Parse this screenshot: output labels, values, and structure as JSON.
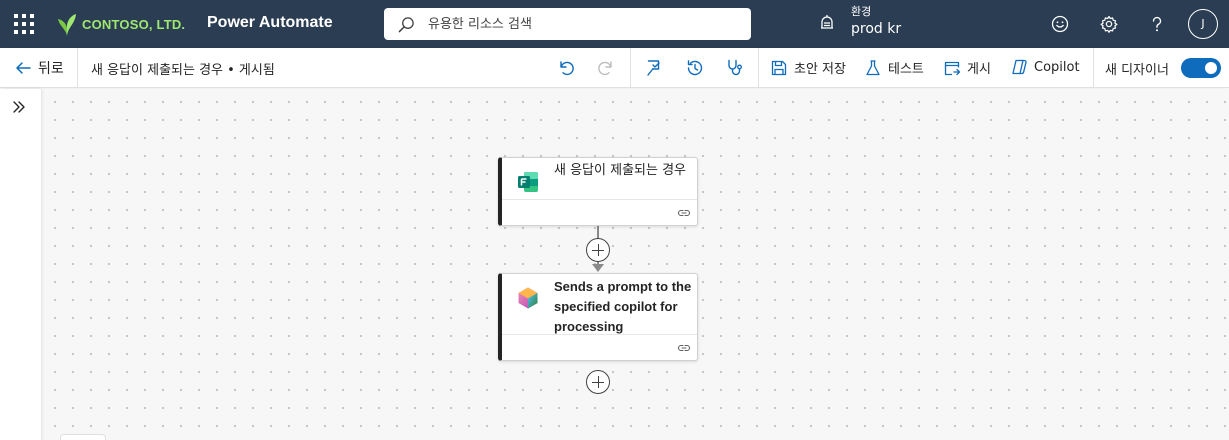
{
  "header": {
    "brand": "CONTOSO, LTD.",
    "app_title": "Power Automate",
    "search_placeholder": "유용한 리소스 검색",
    "environment_label": "환경",
    "environment_name": "prod kr",
    "avatar_initial": "J",
    "icons": [
      "waffle-icon",
      "contoso-leaf-logo",
      "search-icon",
      "environment-icon",
      "feedback-smiley-icon",
      "settings-gear-icon",
      "help-question-icon"
    ]
  },
  "commandbar": {
    "back_label": "뒤로",
    "flow_title": "새 응답이 제출되는 경우 • 게시됨",
    "save_draft": "초안 저장",
    "test": "테스트",
    "publish": "게시",
    "copilot": "Copilot",
    "new_designer": "새 디자이너",
    "new_designer_enabled": true,
    "icons": [
      "undo-icon",
      "redo-icon",
      "flow-checker-icon",
      "version-history-icon",
      "stethoscope-icon"
    ]
  },
  "canvas": {
    "trigger": {
      "title": "새 응답이 제출되는 경우",
      "icon": "microsoft-forms-icon"
    },
    "action": {
      "title": "Sends a prompt to the specified copilot for processing",
      "icon": "copilot-studio-icon"
    }
  },
  "colors": {
    "header_bg": "#2b3d53",
    "brand_green": "#9fe870",
    "accent_blue": "#0f6cbd",
    "forms_teal": "#037f6f"
  }
}
